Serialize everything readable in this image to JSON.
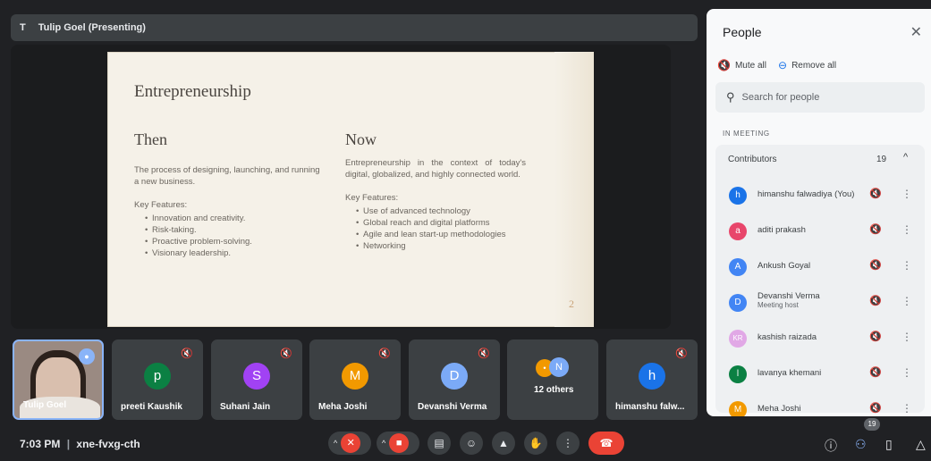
{
  "presenter_bar": {
    "initial": "T",
    "label": "Tulip Goel (Presenting)"
  },
  "slide": {
    "title": "Entrepreneurship",
    "then": {
      "heading": "Then",
      "description": "The process of designing, launching, and running a new business.",
      "features_label": "Key Features:",
      "features": [
        "Innovation and creativity.",
        "Risk-taking.",
        "Proactive problem-solving.",
        "Visionary leadership."
      ]
    },
    "now": {
      "heading": "Now",
      "description": "Entrepreneurship in the context of today's digital, globalized, and highly connected world.",
      "features_label": "Key Features:",
      "features": [
        "Use of advanced technology",
        "Global reach and digital platforms",
        "Agile and lean start-up methodologies",
        "Networking"
      ]
    },
    "page_number": "2"
  },
  "tiles": [
    {
      "name": "Tulip Goel",
      "initial": "",
      "color": ""
    },
    {
      "name": "preeti Kaushik",
      "initial": "p",
      "color": "#0b8043"
    },
    {
      "name": "Suhani Jain",
      "initial": "S",
      "color": "#a142f4"
    },
    {
      "name": "Meha Joshi",
      "initial": "M",
      "color": "#f29900"
    },
    {
      "name": "Devanshi Verma",
      "initial": "D",
      "color": "#7baaf7"
    },
    {
      "name": "12 others",
      "initial": "N",
      "color": "#7baaf7"
    },
    {
      "name": "himanshu falw...",
      "initial": "h",
      "color": "#1a73e8"
    }
  ],
  "bottom_bar": {
    "time": "7:03 PM",
    "separator": "|",
    "meeting_code": "xne-fvxg-cth",
    "people_count": "19"
  },
  "panel": {
    "title": "People",
    "mute_all": "Mute all",
    "remove_all": "Remove all",
    "search_placeholder": "Search for people",
    "section_label": "IN MEETING",
    "group_name": "Contributors",
    "group_count": "19",
    "people": [
      {
        "name": "himanshu falwadiya (You)",
        "sub": "",
        "initial": "h",
        "color": "#1a73e8"
      },
      {
        "name": "aditi prakash",
        "sub": "",
        "initial": "a",
        "color": "#e8466b"
      },
      {
        "name": "Ankush Goyal",
        "sub": "",
        "initial": "A",
        "color": "#4285f4"
      },
      {
        "name": "Devanshi Verma",
        "sub": "Meeting host",
        "initial": "D",
        "color": "#4285f4"
      },
      {
        "name": "kashish raizada",
        "sub": "",
        "initial": "KR",
        "color": "#e1a8e6"
      },
      {
        "name": "lavanya khemani",
        "sub": "",
        "initial": "l",
        "color": "#0b8043"
      },
      {
        "name": "Meha Joshi",
        "sub": "",
        "initial": "M",
        "color": "#f29900"
      }
    ]
  }
}
